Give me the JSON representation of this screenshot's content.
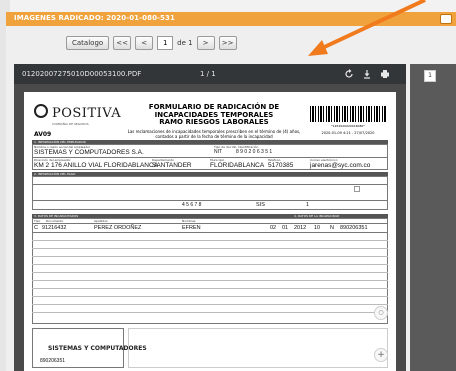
{
  "window": {
    "title": "IMAGENES RADICADO: 2020-01-080-531"
  },
  "toolbar": {
    "catalog_label": "Catalogo",
    "first_label": "<<",
    "prev_label": "<",
    "page_value": "1",
    "of_label": "de 1",
    "next_label": ">",
    "last_label": ">>"
  },
  "viewer": {
    "filename": "01202007275010D00053100.PDF",
    "page_indicator": "1 / 1",
    "thumb_page": "1"
  },
  "document": {
    "logo": "POSITIVA",
    "logo_sub": "COMPAÑIA DE SEGUROS",
    "form_code": "AV09",
    "title_line1": "FORMULARIO DE RADICACIÓN DE",
    "title_line2": "INCAPACIDADES TEMPORALES",
    "title_line3": "RAMO RIESGOS LABORALES",
    "desc": "Las reclamaciones de incapacidades temporales prescriben en el término de (4) años, contados a partir de la fecha de término de la incapacidad",
    "barcode_number": "*1452020020016080*",
    "barcode_date": "2020-01-09 4:21 - 27/07/2020",
    "sec1": "1. INFORMACIÓN DEL EMPLEADOR",
    "lbl_employer": "Nombre o razón social del empleador",
    "employer": "SISTEMAS Y COMPUTADORES S.A.",
    "lbl_nit": "Tipo de doc  No. Identificación",
    "nit_type": "NIT",
    "nit": "8 9 0 2 0 6 3 5 1",
    "lbl_address": "Dirección del empleador",
    "address": "KM 2 176 ANILLO VIAL FLORIDABLANCA",
    "lbl_dept": "Departamento",
    "dept": "SANTANDER",
    "lbl_city": "Municipio",
    "city": "FLORIDABLANCA",
    "lbl_phone": "Teléfono",
    "phone": "5170385",
    "lbl_email": "Correo electrónico",
    "email": "jarenas@syc.com.co",
    "sec2": "2. INFORMACIÓN DEL PAGO",
    "account": "4 5 6 7 8",
    "entity": "SIS",
    "entity_num": "1",
    "sec3": "3. DATOS DE INCAPACITADOS",
    "sec3_right": "4. DATOS DE LA INCAPACIDAD",
    "col_doc_type": "Tipo",
    "col_doc": "Documento",
    "col_last": "Apellidos",
    "col_names": "Nombres",
    "row_type": "C",
    "row_doc": "91216432",
    "row_last": "PEREZ ORDOÑEZ",
    "row_name": "EFREN",
    "row_d": "02",
    "row_m": "01",
    "row_y": "2012",
    "row_days": "10",
    "row_n": "N",
    "row_nit": "890206351",
    "signature_name": "SISTEMAS Y COMPUTADORES",
    "footer_code": "890206351"
  }
}
